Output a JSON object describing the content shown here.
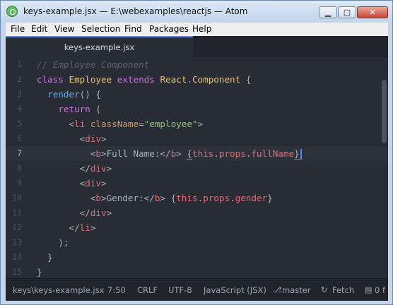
{
  "window": {
    "title": "keys-example.jsx — E:\\webexamples\\reactjs — Atom",
    "icons": {
      "app": "atom-icon",
      "minimize": "minimize-icon",
      "maximize": "maximize-icon",
      "close": "close-icon"
    },
    "glyphs": {
      "minimize": "▁",
      "maximize": "▢",
      "close": "✕"
    }
  },
  "menu": [
    "File",
    "Edit",
    "View",
    "Selection",
    "Find",
    "Packages",
    "Help"
  ],
  "tabs": [
    {
      "label": "keys-example.jsx",
      "active": true
    }
  ],
  "editor": {
    "active_line": 7,
    "line_numbers": [
      "1",
      "2",
      "3",
      "4",
      "5",
      "6",
      "7",
      "8",
      "9",
      "10",
      "11",
      "12",
      "13",
      "14",
      "15"
    ]
  },
  "status": {
    "file": "keys\\keys-example.jsx",
    "cursor": "7:50",
    "line_ending": "CRLF",
    "encoding": "UTF-8",
    "grammar": "JavaScript (JSX)",
    "branch": "master",
    "fetch": "Fetch",
    "files_count": "0 f",
    "branch_icon": "git-branch-icon",
    "fetch_icon": "sync-icon",
    "files_icon": "file-icon"
  },
  "colors": {
    "editor_bg": "#282c34",
    "keyword": "#c678dd",
    "class": "#e5c07b",
    "function": "#61afef",
    "tag": "#e06c75",
    "attribute": "#d19a66",
    "string": "#98c379",
    "comment": "#5c6370"
  }
}
